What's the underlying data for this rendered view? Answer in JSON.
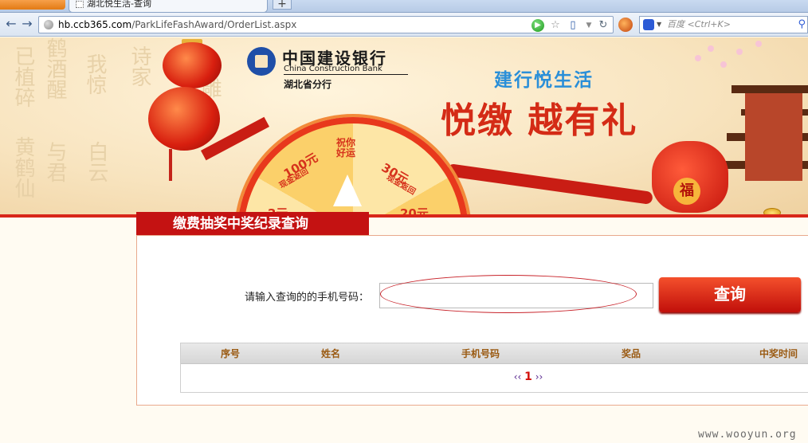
{
  "browser": {
    "tab_title": "湖北悦生活-查询",
    "new_tab": "+",
    "url_host": "hb.ccb365.com",
    "url_path": "/ParkLifeFashAward/OrderList.aspx",
    "search_placeholder": "百度 <Ctrl+K>"
  },
  "banner": {
    "bank_name_cn": "中国建设银行",
    "bank_name_en": "China Construction Bank",
    "bank_branch": "湖北省分行",
    "slogan_small": "建行悦生活",
    "slogan_large": "悦缴 越有礼",
    "wheel_prizes": [
      "祝你好运",
      "100元",
      "现金返回",
      "30元",
      "现金返回",
      "2元",
      "20元"
    ],
    "bag_char": "福",
    "calligraphy": [
      "已植碎",
      "鹤酒醒",
      "我惊",
      "诗家",
      "与君",
      "白云",
      "黄鹤仙",
      "雕"
    ]
  },
  "query": {
    "panel_title": "缴费抽奖中奖纪录查询",
    "phone_label": "请输入查询的的手机号码：",
    "phone_value": "",
    "submit_label": "查询"
  },
  "table": {
    "headers": [
      "序号",
      "姓名",
      "手机号码",
      "奖品",
      "中奖时间"
    ],
    "pager_prev": "‹‹",
    "pager_current": "1",
    "pager_next": "››"
  },
  "watermark": "www.wooyun.org",
  "colors": {
    "brand_red": "#c41212",
    "slogan_blue": "#2a8fd8",
    "header_text": "#9a5a12"
  }
}
